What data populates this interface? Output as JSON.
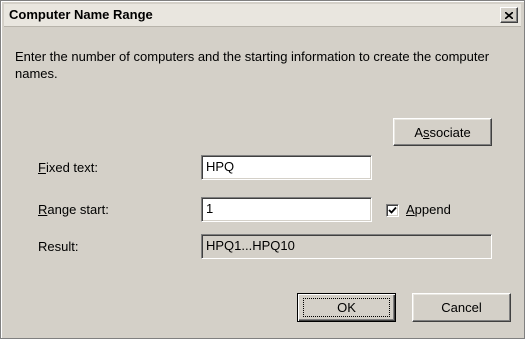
{
  "dialog": {
    "title": "Computer Name Range",
    "close_label": "×",
    "description": "Enter the number of computers and the starting information to create the computer names."
  },
  "associate_button": {
    "pre": "A",
    "mnemonic": "s",
    "post": "sociate"
  },
  "fields": {
    "fixed_text": {
      "mnemonic": "F",
      "rest": "ixed text:",
      "value": "HPQ"
    },
    "range_start": {
      "mnemonic": "R",
      "rest": "ange start:",
      "value": "1"
    },
    "result": {
      "label": "Result:",
      "value": "HPQ1...HPQ10"
    }
  },
  "append": {
    "mnemonic": "A",
    "rest": "ppend",
    "checked": true
  },
  "buttons": {
    "ok": "OK",
    "cancel": "Cancel"
  }
}
